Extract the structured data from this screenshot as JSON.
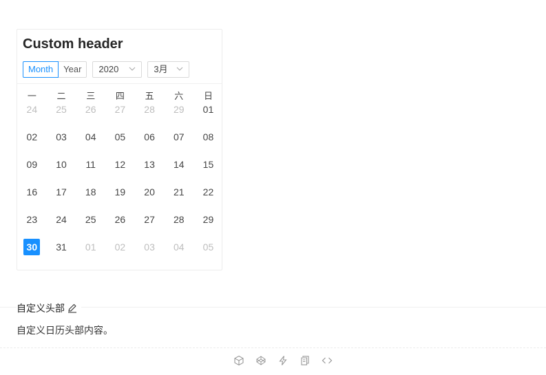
{
  "calendar": {
    "title": "Custom header",
    "mode_options": [
      "Month",
      "Year"
    ],
    "selected_mode": "Month",
    "year_value": "2020",
    "month_value": "3月",
    "weekdays": [
      "一",
      "二",
      "三",
      "四",
      "五",
      "六",
      "日"
    ],
    "weeks": [
      [
        {
          "d": "24",
          "o": true
        },
        {
          "d": "25",
          "o": true
        },
        {
          "d": "26",
          "o": true
        },
        {
          "d": "27",
          "o": true
        },
        {
          "d": "28",
          "o": true
        },
        {
          "d": "29",
          "o": true
        },
        {
          "d": "01",
          "o": false
        }
      ],
      [
        {
          "d": "02",
          "o": false
        },
        {
          "d": "03",
          "o": false
        },
        {
          "d": "04",
          "o": false
        },
        {
          "d": "05",
          "o": false
        },
        {
          "d": "06",
          "o": false
        },
        {
          "d": "07",
          "o": false
        },
        {
          "d": "08",
          "o": false
        }
      ],
      [
        {
          "d": "09",
          "o": false
        },
        {
          "d": "10",
          "o": false
        },
        {
          "d": "11",
          "o": false
        },
        {
          "d": "12",
          "o": false
        },
        {
          "d": "13",
          "o": false
        },
        {
          "d": "14",
          "o": false
        },
        {
          "d": "15",
          "o": false
        }
      ],
      [
        {
          "d": "16",
          "o": false
        },
        {
          "d": "17",
          "o": false
        },
        {
          "d": "18",
          "o": false
        },
        {
          "d": "19",
          "o": false
        },
        {
          "d": "20",
          "o": false
        },
        {
          "d": "21",
          "o": false
        },
        {
          "d": "22",
          "o": false
        }
      ],
      [
        {
          "d": "23",
          "o": false
        },
        {
          "d": "24",
          "o": false
        },
        {
          "d": "25",
          "o": false
        },
        {
          "d": "26",
          "o": false
        },
        {
          "d": "27",
          "o": false
        },
        {
          "d": "28",
          "o": false
        },
        {
          "d": "29",
          "o": false
        }
      ],
      [
        {
          "d": "30",
          "o": false,
          "sel": true
        },
        {
          "d": "31",
          "o": false
        },
        {
          "d": "01",
          "o": true
        },
        {
          "d": "02",
          "o": true
        },
        {
          "d": "03",
          "o": true
        },
        {
          "d": "04",
          "o": true
        },
        {
          "d": "05",
          "o": true
        }
      ]
    ]
  },
  "demo": {
    "section_title": "自定义头部",
    "description": "自定义日历头部内容。",
    "edit_icon": "edit-icon"
  },
  "actions": [
    "codesandbox-icon",
    "codepen-icon",
    "lightning-icon",
    "copy-icon",
    "code-icon"
  ],
  "colors": {
    "accent": "#1890ff",
    "dim_text": "#bdbdbd"
  }
}
